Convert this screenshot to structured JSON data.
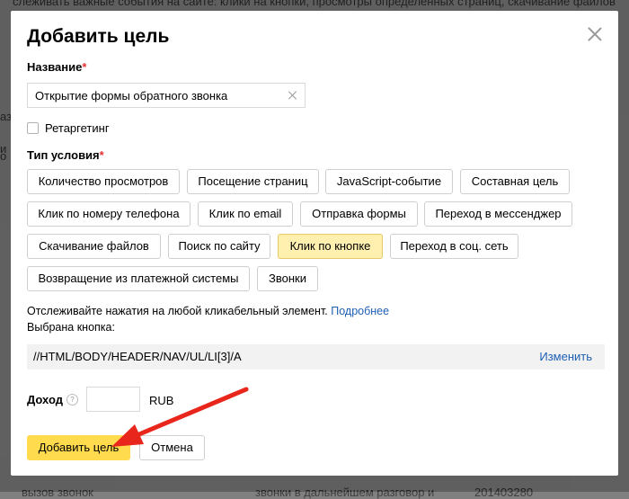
{
  "background": {
    "top_text": "слеживать важные события на сайте: клики на кнопки, просмотры определенных страниц, скачивание файлов",
    "left_1": "аз",
    "left_2": "и",
    "left_3": "о",
    "bottom_1": "вызов звонок",
    "bottom_2": "звонки в дальнейшем разговор и",
    "bottom_3": "201403280"
  },
  "modal": {
    "title": "Добавить цель",
    "name_label": "Название",
    "required_mark": "*",
    "name_value": "Открытие формы обратного звонка",
    "retargeting_label": "Ретаргетинг",
    "retargeting_checked": false,
    "condition_label": "Тип условия",
    "condition_types": [
      "Количество просмотров",
      "Посещение страниц",
      "JavaScript-событие",
      "Составная цель",
      "Клик по номеру телефона",
      "Клик по email",
      "Отправка формы",
      "Переход в мессенджер",
      "Скачивание файлов",
      "Поиск по сайту",
      "Клик по кнопке",
      "Переход в соц. сеть",
      "Возвращение из платежной системы",
      "Звонки"
    ],
    "selected_condition": "Клик по кнопке",
    "description": "Отслеживайте нажатия на любой кликабельный элемент.",
    "more_link": "Подробнее",
    "chosen_label": "Выбрана кнопка:",
    "xpath_value": "//HTML/BODY/HEADER/NAV/UL/LI[3]/A",
    "change_link": "Изменить",
    "income_label": "Доход",
    "help_icon_text": "?",
    "income_value": "",
    "currency": "RUB",
    "add_button": "Добавить цель",
    "cancel_button": "Отмена"
  },
  "colors": {
    "accent_yellow": "#ffdb4d",
    "selected_bg": "#fff0b0",
    "link_blue": "#1c5fb5",
    "required_red": "#e63232",
    "arrow_red": "#e8261c"
  },
  "icons": {
    "close": "close-icon",
    "clear": "clear-icon",
    "help": "help-icon",
    "annotation": "red-arrow-icon"
  }
}
